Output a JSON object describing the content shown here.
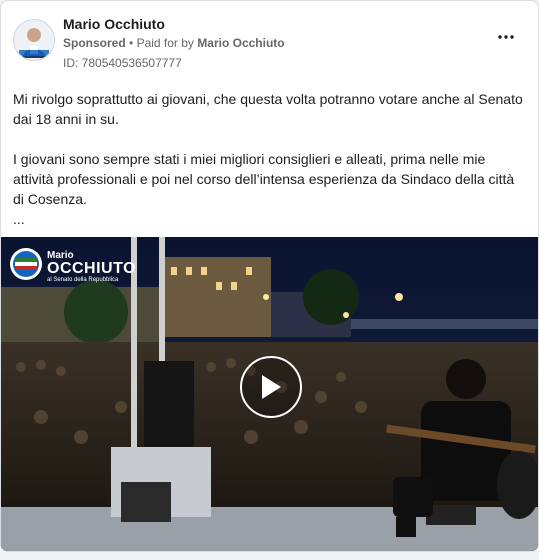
{
  "post": {
    "author": "Mario Occhiuto",
    "sponsored": "Sponsored",
    "paid_prefix": "Paid for by",
    "paid_by": "Mario Occhiuto",
    "ad_id": "ID: 780540536507777",
    "more_icon": "more-horizontal-icon",
    "paragraphs": [
      "Mi rivolgo soprattutto ai giovani, che questa volta potranno votare anche al Senato dai 18 anni in su.",
      "I giovani sono sempre stati i miei migliori consiglieri e alleati, prima nelle mie attività professionali e poi nel corso dell’intensa esperienza da Sindaco della città di Cosenza."
    ],
    "ellipsis": "..."
  },
  "video": {
    "overlay_first_name": "Mario",
    "overlay_last_name": "OCCHIUTO",
    "overlay_subtitle": "al Senato della Repubblica",
    "play_icon": "play-icon"
  },
  "colors": {
    "accent_text": "#1c1e21",
    "muted_text": "#65676b",
    "card_border": "#dadde1"
  }
}
